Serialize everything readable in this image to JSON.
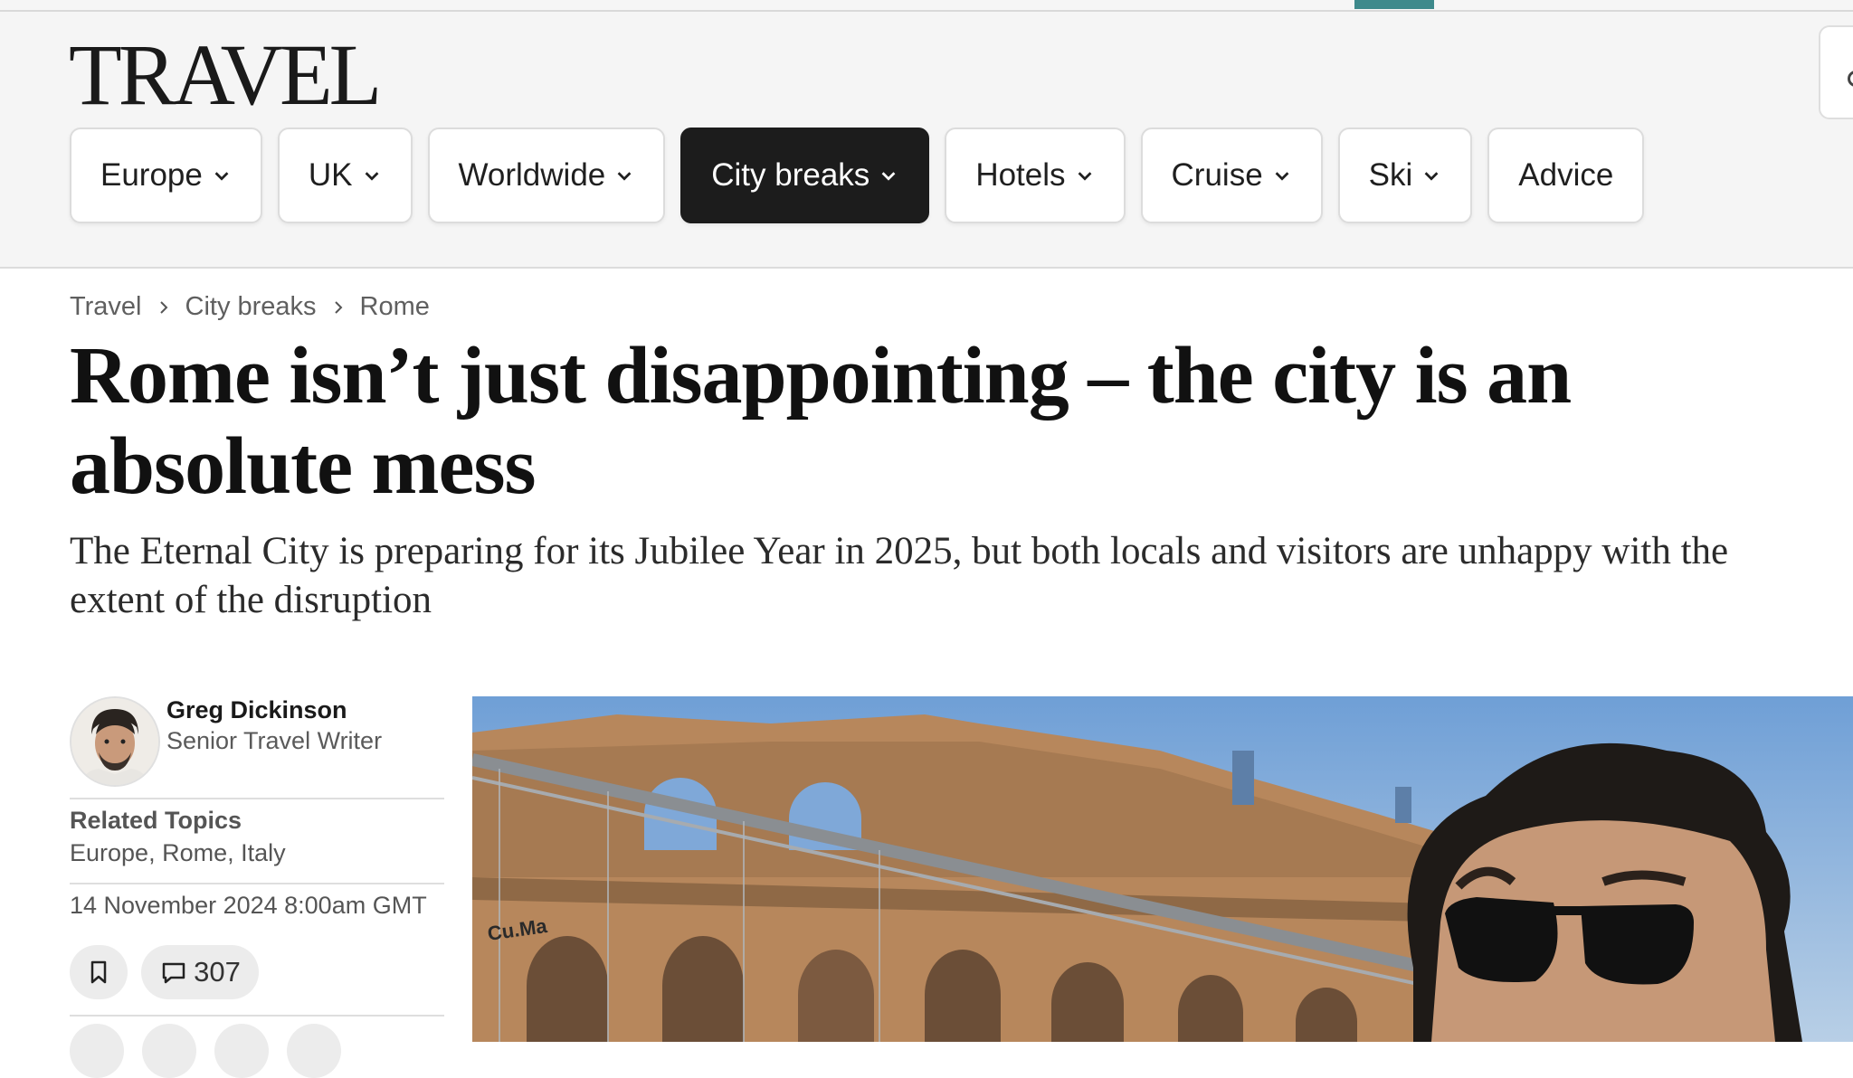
{
  "site": {
    "logo_text": "TRAVEL",
    "accent_color": "#3e8a8c"
  },
  "nav": {
    "items": [
      {
        "label": "Europe",
        "has_dropdown": true,
        "active": false
      },
      {
        "label": "UK",
        "has_dropdown": true,
        "active": false
      },
      {
        "label": "Worldwide",
        "has_dropdown": true,
        "active": false
      },
      {
        "label": "City breaks",
        "has_dropdown": true,
        "active": true
      },
      {
        "label": "Hotels",
        "has_dropdown": true,
        "active": false
      },
      {
        "label": "Cruise",
        "has_dropdown": true,
        "active": false
      },
      {
        "label": "Ski",
        "has_dropdown": true,
        "active": false
      },
      {
        "label": "Advice",
        "has_dropdown": false,
        "active": false
      }
    ],
    "search_icon": "search-icon"
  },
  "breadcrumb": {
    "items": [
      "Travel",
      "City breaks",
      "Rome"
    ],
    "separator_icon": "chevron-right-icon"
  },
  "article": {
    "headline": "Rome isn’t just disappointing – the city is an absolute mess",
    "standfirst": "The Eternal City is preparing for its Jubilee Year in 2025, but both locals and visitors are unhappy with the extent of the disruption"
  },
  "byline": {
    "author_name": "Greg Dickinson",
    "author_role": "Senior Travel Writer",
    "related_label": "Related Topics",
    "related_topics": "Europe, Rome, Italy",
    "published": "14 November 2024 8:00am GMT",
    "comment_count": "307"
  },
  "hero_image": {
    "subject": "Man in sunglasses taking a selfie in front of the Colosseum",
    "sign_text": "Cu.Ma"
  }
}
